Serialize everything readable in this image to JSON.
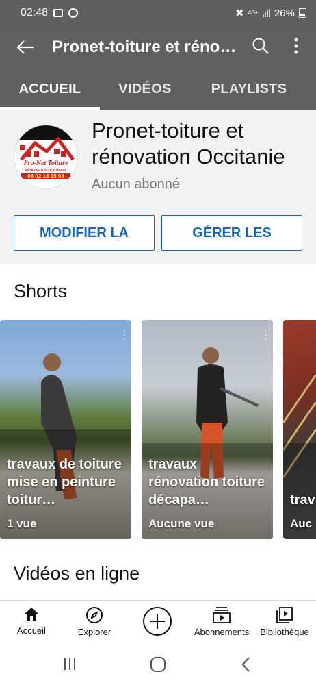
{
  "status_bar": {
    "time": "02:48",
    "network": "4G+",
    "battery": "26%"
  },
  "app_bar": {
    "title": "Pronet-toiture et réno…"
  },
  "tabs": [
    {
      "label": "ACCUEIL",
      "active": true
    },
    {
      "label": "VIDÉOS",
      "active": false
    },
    {
      "label": "PLAYLISTS",
      "active": false
    }
  ],
  "channel": {
    "name": "Pronet-toiture et rénovation Occitanie",
    "subscribers": "Aucun abonné",
    "logo_text": "Pro-Net Toiture",
    "logo_sub": "RÉNOVATION OCCITANIE",
    "logo_phone": "06 02 18 15 93",
    "buttons": {
      "edit": "MODIFIER LA",
      "manage": "GÉRER LES"
    }
  },
  "sections": {
    "shorts_title": "Shorts",
    "videos_title": "Vidéos en ligne"
  },
  "shorts": [
    {
      "caption": "travaux de toiture mise en peinture toitur…",
      "views": "1 vue"
    },
    {
      "caption": "travaux rénovation toiture décapa…",
      "views": "Aucune vue"
    },
    {
      "caption": "trav cou",
      "views": "Auc"
    }
  ],
  "bottom_nav": [
    {
      "label": "Accueil",
      "icon": "home-icon"
    },
    {
      "label": "Explorer",
      "icon": "compass-icon"
    },
    {
      "label": "",
      "icon": "add-circle-icon"
    },
    {
      "label": "Abonnements",
      "icon": "subscriptions-icon"
    },
    {
      "label": "Bibliothèque",
      "icon": "library-icon"
    }
  ],
  "colors": {
    "header": "#606060",
    "accent": "#1565c0",
    "channel_bg": "#f2f2f2"
  }
}
